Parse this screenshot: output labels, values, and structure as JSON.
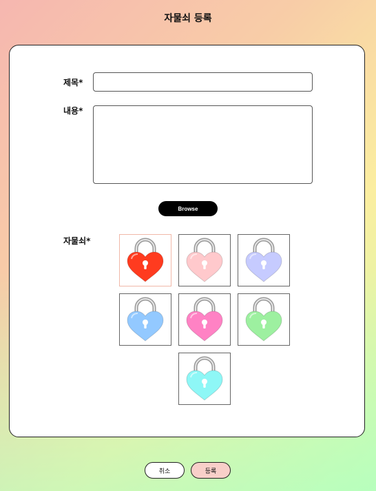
{
  "page": {
    "title": "자물쇠 등록"
  },
  "form": {
    "title_label": "제목*",
    "title_value": "",
    "content_label": "내용*",
    "content_value": "",
    "browse_label": "Browse",
    "lock_label": "자물쇠*"
  },
  "locks": [
    {
      "name": "red-heart-lock-icon",
      "color": "#ff3b1f",
      "selected": true
    },
    {
      "name": "pink-heart-lock-icon",
      "color": "#ffc9cc",
      "selected": false
    },
    {
      "name": "lavender-heart-lock-icon",
      "color": "#c6cbff",
      "selected": false
    },
    {
      "name": "blue-heart-lock-icon",
      "color": "#93c9ff",
      "selected": false
    },
    {
      "name": "magenta-heart-lock-icon",
      "color": "#ff82c4",
      "selected": false
    },
    {
      "name": "green-heart-lock-icon",
      "color": "#9df0a0",
      "selected": false
    },
    {
      "name": "cyan-heart-lock-icon",
      "color": "#8ef7f6",
      "selected": false
    }
  ],
  "actions": {
    "cancel_label": "취소",
    "submit_label": "등록"
  }
}
